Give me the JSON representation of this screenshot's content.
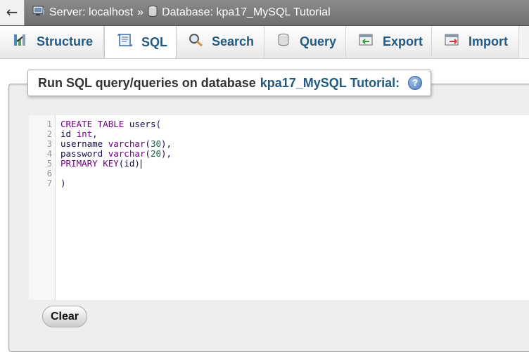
{
  "breadcrumb": {
    "back_glyph": "←",
    "server_label": "Server: localhost",
    "separator": "»",
    "database_label": "Database: kpa17_MySQL Tutorial"
  },
  "tabs": [
    {
      "label": "Structure",
      "icon": "structure-icon",
      "active": false
    },
    {
      "label": "SQL",
      "icon": "sql-icon",
      "active": true
    },
    {
      "label": "Search",
      "icon": "search-icon",
      "active": false
    },
    {
      "label": "Query",
      "icon": "query-icon",
      "active": false
    },
    {
      "label": "Export",
      "icon": "export-icon",
      "active": false
    },
    {
      "label": "Import",
      "icon": "import-icon",
      "active": false
    }
  ],
  "panel": {
    "heading_prefix": "Run SQL query/queries on database",
    "database_name": "kpa17_MySQL Tutorial:",
    "help_glyph": "?"
  },
  "editor": {
    "line_numbers": [
      "1",
      "2",
      "3",
      "4",
      "5",
      "6",
      "7"
    ],
    "lines": [
      "CREATE TABLE users(",
      "id int,",
      "username varchar(30),",
      "password varchar(20),",
      "PRIMARY KEY(id)",
      "",
      ")"
    ]
  },
  "buttons": {
    "clear_label": "Clear"
  },
  "colors": {
    "tab_text": "#235a81",
    "keyword": "#770088",
    "number": "#116644",
    "topbar": "#7d7d7d"
  }
}
